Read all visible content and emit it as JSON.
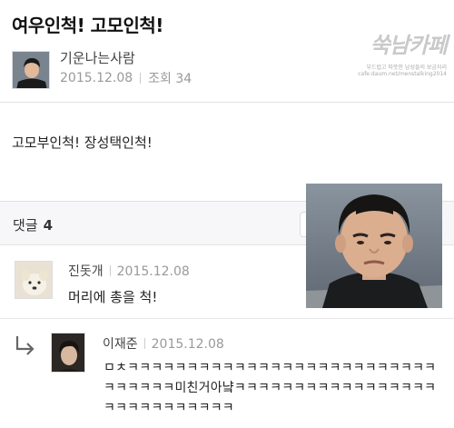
{
  "post": {
    "title": "여우인척! 고모인척!",
    "author": "기운나는사람",
    "date": "2015.12.08",
    "views_label": "조회 34",
    "body": "고모부인척! 장성택인척!"
  },
  "cafe_logo": {
    "title": "쑥남카페",
    "tagline": "부드럽고 따뜻한 남성들의 보금자리",
    "url": "cafe.daum.net/menstalking2014"
  },
  "comments": {
    "label": "댓글",
    "count": "4",
    "items": [
      {
        "author": "진돗개",
        "date": "2015.12.08",
        "text": "머리에 총을 척!"
      },
      {
        "author": "이재준",
        "date": "2015.12.08",
        "text": "ㅁㅊㅋㅋㅋㅋㅋㅋㅋㅋㅋㅋㅋㅋㅋㅋㅋㅋㅋㅋㅋㅋㅋㅋㅋㅋㅋㅋㅋㅋㅋㅋㅋㅋ미친거아냨ㅋㅋㅋㅋㅋㅋㅋㅋㅋㅋㅋㅋㅋㅋㅋㅋㅋㅋㅋㅋㅋㅋㅋㅋㅋㅋㅋㅋ"
      }
    ]
  },
  "colors": {
    "text": "#222222",
    "muted": "#999999",
    "divider": "#e3e3e3",
    "comments_bg": "#f7f7f9"
  },
  "icons": [
    "reply-arrow-icon"
  ]
}
